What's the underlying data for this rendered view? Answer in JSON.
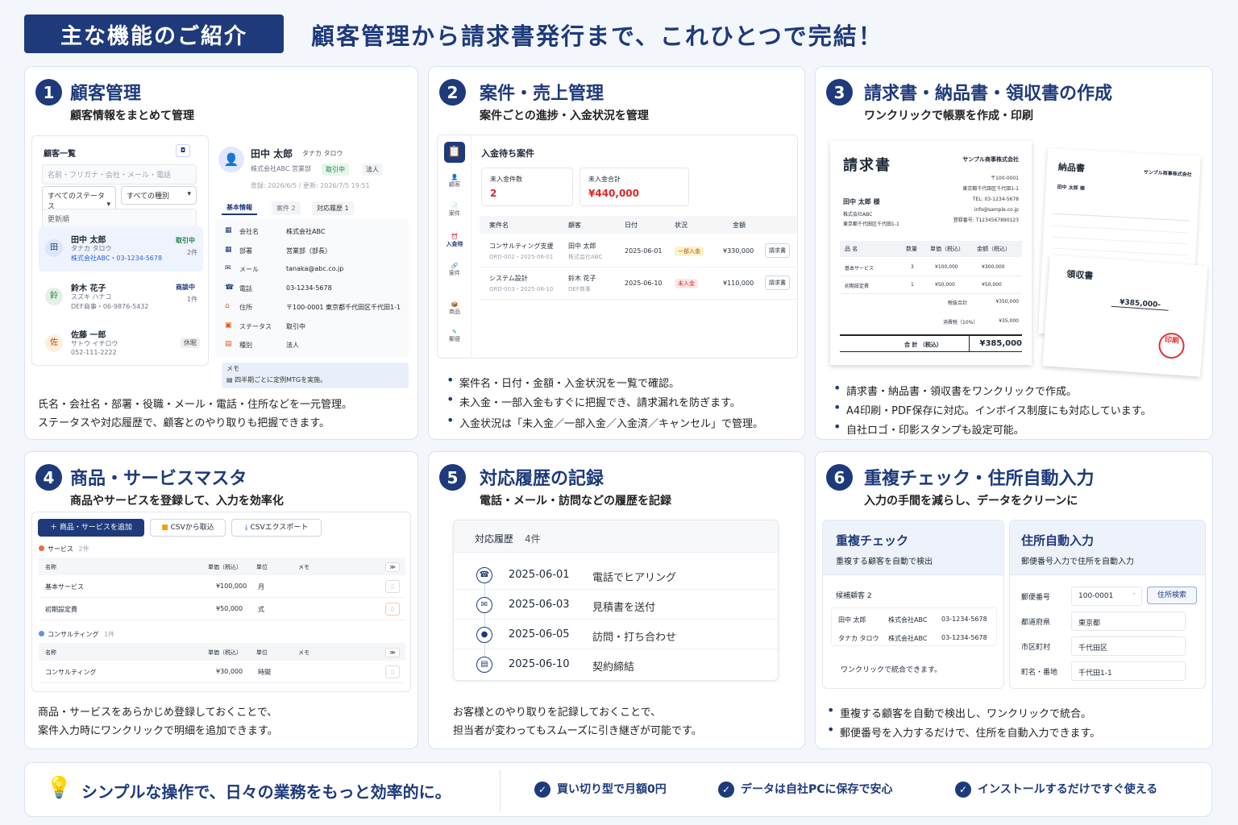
{
  "header": {
    "badge": "主な機能のご紹介",
    "title": "顧客管理から請求書発行まで、これひとつで完結！"
  },
  "p1": {
    "num": "1",
    "title": "顧客管理",
    "sub": "顧客情報をまとめて管理",
    "list_title": "顧客一覧",
    "search_placeholder": "名前・フリガナ・会社・メール・電話",
    "status_select": "すべてのステータス",
    "kind_select": "すべての種別",
    "sort": "更新順",
    "customers": [
      {
        "icon": "田",
        "name": "田中 太郎",
        "kana": "タナカ タロウ",
        "info": "株式会社ABC・03-1234-5678",
        "status": "取引中",
        "count": "2件"
      },
      {
        "icon": "鈴",
        "name": "鈴木 花子",
        "kana": "スズキ ハナコ",
        "info": "DEF商事・06-9876-5432",
        "status": "商談中",
        "count": "1件"
      },
      {
        "icon": "佐",
        "name": "佐藤 一郎",
        "kana": "サトウ イチロウ",
        "info": "052-111-2222",
        "status": "休眠",
        "count": ""
      }
    ],
    "detail": {
      "name": "田中 太郎",
      "kana": "タナカ タロウ",
      "company": "株式会社ABC 営業部",
      "status": "取引中",
      "kind": "法人",
      "dates": "登録: 2026/6/5 / 更新: 2026/7/5 19:51",
      "tabs": [
        "基本情報",
        "案件 2",
        "対応履歴 1"
      ],
      "fields": [
        {
          "label": "会社名",
          "value": "株式会社ABC"
        },
        {
          "label": "部署",
          "value": "営業部（部長）"
        },
        {
          "label": "メール",
          "value": "tanaka@abc.co.jp"
        },
        {
          "label": "電話",
          "value": "03-1234-5678"
        },
        {
          "label": "住所",
          "value": "〒100-0001 東京都千代田区千代田1-1"
        },
        {
          "label": "ステータス",
          "value": "取引中"
        },
        {
          "label": "種別",
          "value": "法人"
        }
      ],
      "memo_label": "メモ",
      "memo": "四半期ごとに定例MTGを実施。"
    },
    "desc": [
      "氏名・会社名・部署・役職・メール・電話・住所などを一元管理。",
      "ステータスや対応履歴で、顧客とのやり取りも把握できます。"
    ]
  },
  "p2": {
    "num": "2",
    "title": "案件・売上管理",
    "sub": "案件ごとの進捗・入金状況を管理",
    "nav": [
      "顧客",
      "案件",
      "入金待",
      "案件",
      "商品",
      "郵便"
    ],
    "heading": "入金待ち案件",
    "stat1_label": "未入金件数",
    "stat1_value": "2",
    "stat2_label": "未入金合計",
    "stat2_value": "¥440,000",
    "cols": [
      "案件名",
      "顧客",
      "日付",
      "状況",
      "金額"
    ],
    "rows": [
      {
        "name": "コンサルティング支援",
        "sub": "ORD-002・2025-06-01",
        "cust": "田中 太郎",
        "cust_sub": "株式会社ABC",
        "date": "2025-06-01",
        "status": "一部入金",
        "amount": "¥330,000",
        "btn": "請求書"
      },
      {
        "name": "システム設計",
        "sub": "ORD-003・2025-06-10",
        "cust": "鈴木 花子",
        "cust_sub": "DEF商事",
        "date": "2025-06-10",
        "status": "未入金",
        "amount": "¥110,000",
        "btn": "請求書"
      }
    ],
    "bullets": [
      "案件名・日付・金額・入金状況を一覧で確認。",
      "未入金・一部入金もすぐに把握でき、請求漏れを防ぎます。",
      "入金状況は「未入金／一部入金／入金済／キャンセル」で管理。"
    ]
  },
  "p3": {
    "num": "3",
    "title": "請求書・納品書・領収書の作成",
    "sub": "ワンクリックで帳票を作成・印刷",
    "invoice": {
      "title": "請求書",
      "company": "サンプル商事株式会社",
      "addr": [
        "〒100-0001",
        "東京都千代田区千代田1-1",
        "TEL: 03-1234-5678",
        "info@sample.co.jp",
        "登録番号: T1234567890123"
      ],
      "to": "田中 太郎 様",
      "to_co": "株式会社ABC",
      "to_addr": "東京都千代田区千代田1-1",
      "cols": [
        "品 名",
        "数量",
        "単価（税込）",
        "金額（税込）"
      ],
      "items": [
        {
          "name": "基本サービス",
          "qty": "3",
          "price": "¥100,000",
          "amt": "¥300,000"
        },
        {
          "name": "初期設定費",
          "qty": "1",
          "price": "¥50,000",
          "amt": "¥50,000"
        }
      ],
      "sub_label": "税抜合計",
      "sub_val": "¥350,000",
      "tax_label": "消費税（10%）",
      "tax_val": "¥35,000",
      "total_label": "合 計 （税込）",
      "total_val": "¥385,000"
    },
    "delivery": {
      "title": "納品書",
      "company": "サンプル商事株式会社",
      "to": "田中 太郎 様"
    },
    "receipt": {
      "title": "領収書",
      "amount": "¥385,000-",
      "stamp": "印刷"
    },
    "bullets": [
      "請求書・納品書・領収書をワンクリックで作成。",
      "A4印刷・PDF保存に対応。インボイス制度にも対応しています。",
      "自社ロゴ・印影スタンプも設定可能。"
    ]
  },
  "p4": {
    "num": "4",
    "title": "商品・サービスマスタ",
    "sub": "商品やサービスを登録して、入力を効率化",
    "btn_add": "＋ 商品・サービスを追加",
    "btn_import": "CSVから取込",
    "btn_export": "CSVエクスポート",
    "groups": [
      {
        "name": "サービス",
        "count": "2件",
        "color": "#ef6c3a",
        "rows": [
          {
            "name": "基本サービス",
            "price": "¥100,000",
            "unit": "月"
          },
          {
            "name": "初期設定費",
            "price": "¥50,000",
            "unit": "式"
          }
        ]
      },
      {
        "name": "コンサルティング",
        "count": "1件",
        "color": "#6b8fd6",
        "rows": [
          {
            "name": "コンサルティング",
            "price": "¥30,000",
            "unit": "時間"
          }
        ]
      }
    ],
    "cols": [
      "名称",
      "単価（税込）",
      "単位",
      "メモ"
    ],
    "desc": [
      "商品・サービスをあらかじめ登録しておくことで、",
      "案件入力時にワンクリックで明細を追加できます。"
    ]
  },
  "p5": {
    "num": "5",
    "title": "対応履歴の記録",
    "sub": "電話・メール・訪問などの履歴を記録",
    "heading": "対応履歴",
    "count": "4件",
    "items": [
      {
        "date": "2025-06-01",
        "text": "電話でヒアリング",
        "icon": "☎"
      },
      {
        "date": "2025-06-03",
        "text": "見積書を送付",
        "icon": "✉"
      },
      {
        "date": "2025-06-05",
        "text": "訪問・打ち合わせ",
        "icon": "●"
      },
      {
        "date": "2025-06-10",
        "text": "契約締結",
        "icon": "▤"
      }
    ],
    "desc": [
      "お客様とのやり取りを記録しておくことで、",
      "担当者が変わってもスムーズに引き継ぎが可能です。"
    ]
  },
  "p6": {
    "num": "6",
    "title": "重複チェック・住所自動入力",
    "sub": "入力の手間を減らし、データをクリーンに",
    "dup": {
      "title": "重複チェック",
      "sub": "重複する顧客を自動で検出",
      "cand": "候補顧客 2",
      "rows": [
        {
          "name": "田中 太郎",
          "co": "株式会社ABC",
          "tel": "03-1234-5678"
        },
        {
          "name": "タナカ タロウ",
          "co": "株式会社ABC",
          "tel": "03-1234-5678"
        }
      ],
      "note": "ワンクリックで統合できます。"
    },
    "addr": {
      "title": "住所自動入力",
      "sub": "郵便番号入力で住所を自動入力",
      "fields": [
        {
          "label": "郵便番号",
          "value": "100-0001"
        },
        {
          "label": "都道府県",
          "value": "東京都"
        },
        {
          "label": "市区町村",
          "value": "千代田区"
        },
        {
          "label": "町名・番地",
          "value": "千代田1-1"
        }
      ],
      "btn": "住所検索"
    },
    "bullets": [
      "重複する顧客を自動で検出し、ワンクリックで統合。",
      "郵便番号を入力するだけで、住所を自動入力できます。"
    ]
  },
  "footer": {
    "tagline": "シンプルな操作で、日々の業務をもっと効率的に。",
    "points": [
      "買い切り型で月額0円",
      "データは自社PCに保存で安心",
      "インストールするだけですぐ使える"
    ]
  }
}
